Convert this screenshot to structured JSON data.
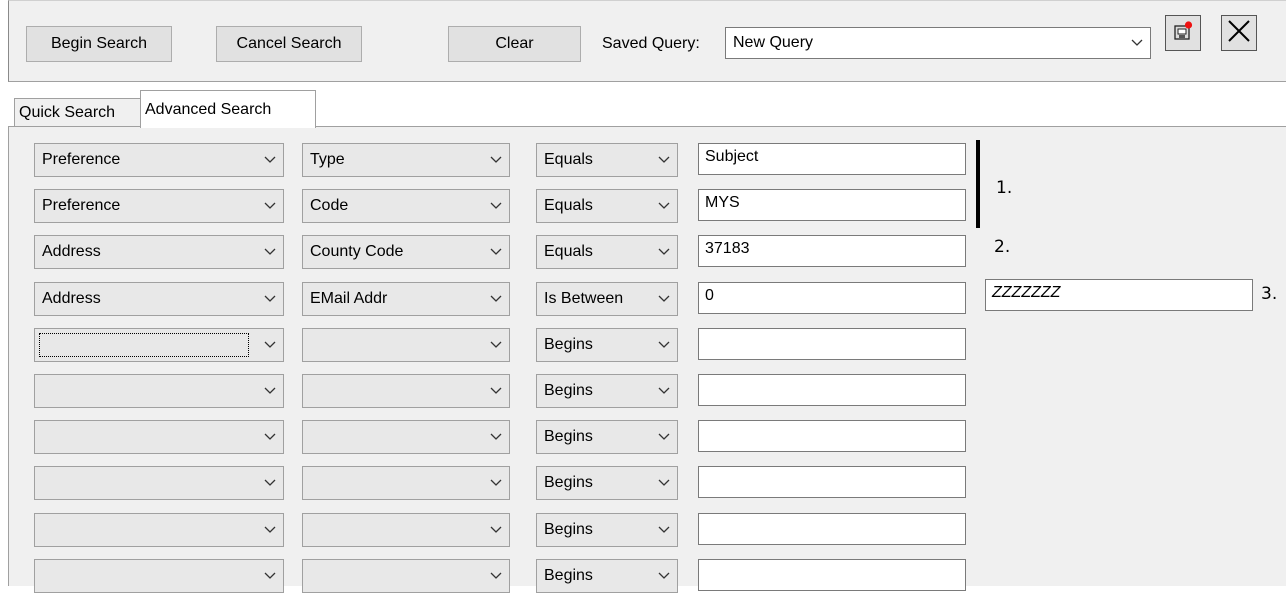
{
  "toolbar": {
    "begin_search": "Begin Search",
    "cancel_search": "Cancel Search",
    "clear": "Clear",
    "saved_query_label": "Saved Query:",
    "saved_query_value": "New Query",
    "icons": [
      "save-query-icon",
      "close-x-icon"
    ]
  },
  "tabs": [
    {
      "label": "Quick Search",
      "active": false
    },
    {
      "label": "Advanced Search",
      "active": true
    }
  ],
  "rows": [
    {
      "category": "Preference",
      "field": "Type",
      "operator": "Equals",
      "value": "Subject"
    },
    {
      "category": "Preference",
      "field": "Code",
      "operator": "Equals",
      "value": "MYS"
    },
    {
      "category": "Address",
      "field": "County Code",
      "operator": "Equals",
      "value": "37183"
    },
    {
      "category": "Address",
      "field": "EMail Addr",
      "operator": "Is Between",
      "value": "0"
    },
    {
      "category": "",
      "field": "",
      "operator": "Begins",
      "value": ""
    },
    {
      "category": "",
      "field": "",
      "operator": "Begins",
      "value": ""
    },
    {
      "category": "",
      "field": "",
      "operator": "Begins",
      "value": ""
    },
    {
      "category": "",
      "field": "",
      "operator": "Begins",
      "value": ""
    },
    {
      "category": "",
      "field": "",
      "operator": "Begins",
      "value": ""
    },
    {
      "category": "",
      "field": "",
      "operator": "Begins",
      "value": ""
    }
  ],
  "between_upper_value": "ZZZZZZZ",
  "annotations": {
    "m1": "1.",
    "m2": "2.",
    "m3": "3."
  }
}
